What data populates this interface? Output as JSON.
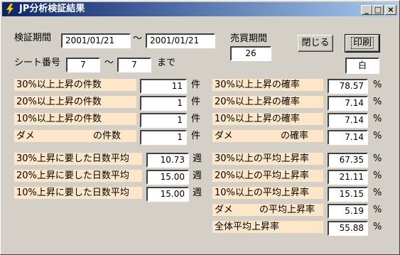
{
  "window": {
    "title": "JP分析検証結果",
    "minimize": "_",
    "maximize": "□",
    "close": "×"
  },
  "period": {
    "label": "検証期間",
    "from": "2001/01/21",
    "tilde": "〜",
    "to": "2001/01/21"
  },
  "sales_period": {
    "label": "売買期間",
    "value": "26"
  },
  "buttons": {
    "close": "閉じる",
    "print": "印刷",
    "color": "白"
  },
  "sheet": {
    "label": "シート番号",
    "from": "7",
    "tilde": "〜",
    "to": "7",
    "suffix": "まで"
  },
  "counts": [
    {
      "label": "30%以上上昇の件数",
      "value": "11",
      "unit": "件"
    },
    {
      "label": "20%以上上昇の件数",
      "value": "1",
      "unit": "件"
    },
    {
      "label": "10%以上上昇の件数",
      "value": "1",
      "unit": "件"
    },
    {
      "label_pre": "ダメ",
      "label_post": "の件数",
      "value": "1",
      "unit": "件"
    }
  ],
  "probabilities": [
    {
      "label": "30%以上上昇の確率",
      "value": "78.57",
      "unit": "%"
    },
    {
      "label": "20%以上上昇の確率",
      "value": "7.14",
      "unit": "%"
    },
    {
      "label": "10%以上上昇の確率",
      "value": "7.14",
      "unit": "%"
    },
    {
      "label_pre": "ダメ",
      "label_post": "の確率",
      "value": "7.14",
      "unit": "%"
    }
  ],
  "days": [
    {
      "label": "30%上昇に要した日数平均",
      "value": "10.73",
      "unit": "週"
    },
    {
      "label": "20%上昇に要した日数平均",
      "value": "15.00",
      "unit": "週"
    },
    {
      "label": "10%上昇に要した日数平均",
      "value": "15.00",
      "unit": "週"
    }
  ],
  "averages": [
    {
      "label": "30%以上の平均上昇率",
      "value": "67.35",
      "unit": "%"
    },
    {
      "label": "20%以上の平均上昇率",
      "value": "21.11",
      "unit": "%"
    },
    {
      "label": "10%以上の平均上昇率",
      "value": "15.15",
      "unit": "%"
    },
    {
      "label_pre": "ダメ",
      "label_post": "の平均上昇率",
      "value": "5.19",
      "unit": "%"
    },
    {
      "label": "全体平均上昇率",
      "value": "55.88",
      "unit": "%"
    }
  ],
  "colors": {
    "label_bg": "#fde7c8",
    "title_start": "#0a246a",
    "title_end": "#a6caf0",
    "face": "#d4d0c8"
  }
}
